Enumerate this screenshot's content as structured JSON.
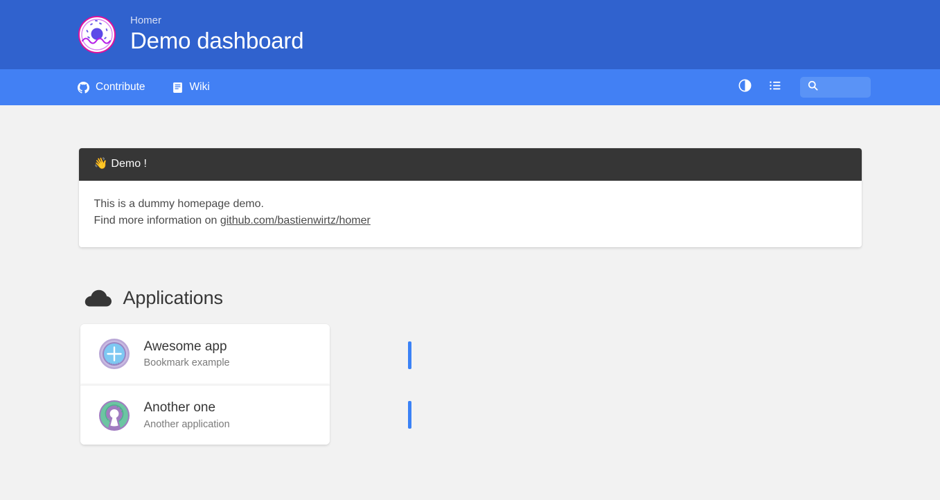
{
  "header": {
    "subtitle": "Homer",
    "title": "Demo dashboard",
    "logo_icon": "donut-icon",
    "bg_color": "#3062ce"
  },
  "navbar": {
    "bg_color": "#4280f4",
    "links": [
      {
        "label": "Contribute",
        "icon": "github-icon"
      },
      {
        "label": "Wiki",
        "icon": "book-icon"
      }
    ],
    "buttons": [
      {
        "name": "theme-toggle",
        "icon": "contrast-circle-icon"
      },
      {
        "name": "layout-toggle",
        "icon": "list-icon"
      }
    ],
    "search": {
      "icon": "search-icon",
      "value": "",
      "placeholder": ""
    }
  },
  "message": {
    "emoji": "👋",
    "heading": "Demo !",
    "line1": "This is a dummy homepage demo.",
    "line2_prefix": "Find more information on ",
    "link_text": "github.com/bastienwirtz/homer",
    "head_bg": "#363636"
  },
  "group": {
    "icon": "cloud-icon",
    "label": "Applications",
    "accent_color": "#3b82f6",
    "items": [
      {
        "name": "Awesome app",
        "subtitle": "Bookmark example",
        "icon": "plus-circle-badge-icon"
      },
      {
        "name": "Another one",
        "subtitle": "Another application",
        "icon": "open-source-icon"
      }
    ]
  }
}
